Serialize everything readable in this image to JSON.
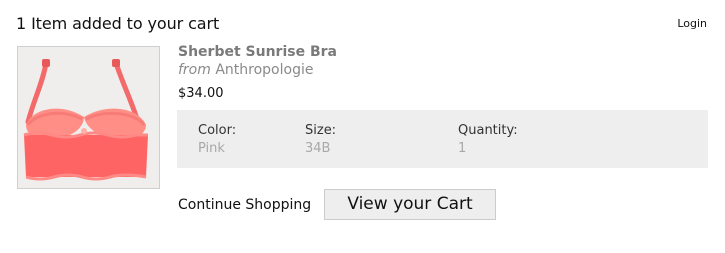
{
  "header": {
    "title": "1 Item added to your cart",
    "login_label": "Login"
  },
  "product": {
    "name": "Sherbet Sunrise Bra",
    "from_label": "from",
    "brand": "Anthropologie",
    "price": "$34.00",
    "image_icon": "bra-product-photo",
    "accent_color": "#ff6f70"
  },
  "options": {
    "color_label": "Color:",
    "color_value": "Pink",
    "size_label": "Size:",
    "size_value": "34B",
    "quantity_label": "Quantity:",
    "quantity_value": "1"
  },
  "actions": {
    "continue_label": "Continue Shopping",
    "view_cart_label": "View your Cart"
  }
}
